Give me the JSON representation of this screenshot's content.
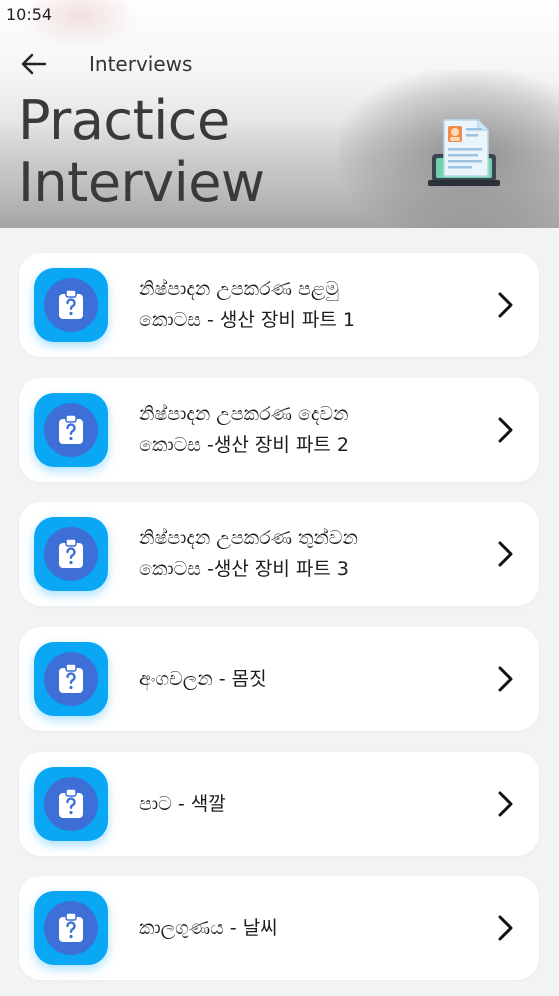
{
  "status_bar": {
    "time": "10:54"
  },
  "header": {
    "back_icon": "arrow-left-icon",
    "title": "Interviews",
    "heading_line1": "Practice",
    "heading_line2": "Interview",
    "illustration_icon": "resume-laptop-icon"
  },
  "list": {
    "item_icon": "clipboard-question-icon",
    "chevron_icon": "chevron-right-icon",
    "accent_color": "#0aa7f5",
    "items": [
      {
        "line1": "නිෂ්පාදන උපකරණ පළමු",
        "line2": "කොටස - 생산 장비  파트 1"
      },
      {
        "line1": "නිෂ්පාදන උපකරණ දෙවන",
        "line2": "කොටස -생산 장비  파트 2"
      },
      {
        "line1": "නිෂ්පාදන උපකරණ තුන්වන",
        "line2": "කොටස -생산 장비  파트 3"
      },
      {
        "line1": "අංගචලන - 몸짓",
        "line2": ""
      },
      {
        "line1": "පාට - 색깔",
        "line2": ""
      },
      {
        "line1": "කාලගුණය - 날씨",
        "line2": ""
      }
    ]
  }
}
